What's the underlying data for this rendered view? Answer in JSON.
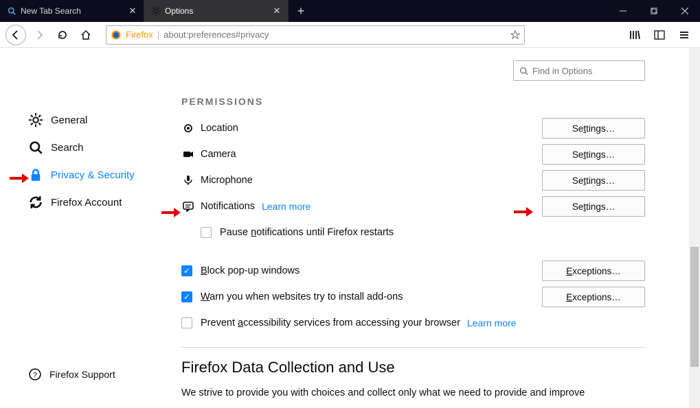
{
  "titlebar": {
    "tabs": [
      {
        "label": "New Tab Search",
        "icon": "search"
      },
      {
        "label": "Options",
        "icon": "gear"
      }
    ],
    "active_tab_index": 1
  },
  "urlbar": {
    "identity": "Firefox",
    "url": "about:preferences#privacy"
  },
  "search": {
    "placeholder": "Find in Options"
  },
  "sidebar": {
    "items": [
      {
        "id": "general",
        "label": "General"
      },
      {
        "id": "search",
        "label": "Search"
      },
      {
        "id": "privacy",
        "label": "Privacy & Security"
      },
      {
        "id": "sync",
        "label": "Firefox Account"
      }
    ],
    "active": "privacy",
    "footer": "Firefox Support"
  },
  "permissions": {
    "header": "PERMISSIONS",
    "location": {
      "label": "Location",
      "button": "Settings…"
    },
    "camera": {
      "label": "Camera",
      "button": "Settings…"
    },
    "microphone": {
      "label": "Microphone",
      "button": "Settings…"
    },
    "notifications": {
      "label": "Notifications",
      "learn": "Learn more",
      "button": "Settings…",
      "pause": "Pause notifications until Firefox restarts"
    },
    "popup": {
      "label": "Block pop-up windows",
      "button": "Exceptions…"
    },
    "addons": {
      "label": "Warn you when websites try to install add-ons",
      "button": "Exceptions…"
    },
    "a11y": {
      "label": "Prevent accessibility services from accessing your browser",
      "learn": "Learn more"
    }
  },
  "data_section": {
    "heading": "Firefox Data Collection and Use",
    "text": "We strive to provide you with choices and collect only what we need to provide and improve"
  }
}
